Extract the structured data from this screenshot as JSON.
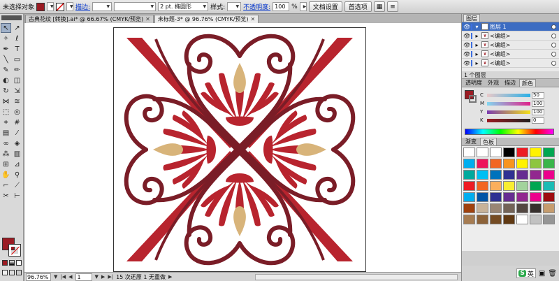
{
  "control_bar": {
    "selection_label": "未选择对象",
    "fill_color": "#9b1b23",
    "stroke_label": "描边:",
    "stroke_width": "",
    "brush_label": "2 pt. 椭圆形",
    "style_label": "样式:",
    "opacity_label": "不透明度:",
    "opacity_value": "100",
    "opacity_unit": "%",
    "doc_setup_button": "文档设置",
    "preferences_button": "首选项"
  },
  "document_tabs": [
    {
      "label": "古典花纹 [转换].ai* @ 66.67% (CMYK/预览)",
      "active": false
    },
    {
      "label": "未标题-3* @ 96.76% (CMYK/预览)",
      "active": true
    }
  ],
  "status_bar": {
    "zoom": "96.76%",
    "page": "1",
    "message": "15 次还原 1 无重做"
  },
  "layers_panel": {
    "tabs": [
      "图层"
    ],
    "rows": [
      {
        "name": "图层 1",
        "main": true
      },
      {
        "name": "<编组>",
        "main": false
      },
      {
        "name": "<编组>",
        "main": false
      },
      {
        "name": "<编组>",
        "main": false
      },
      {
        "name": "<编组>",
        "main": false
      }
    ],
    "footer": "1 个图层"
  },
  "color_panel": {
    "tabs": [
      "透明度",
      "外观",
      "描边",
      "颜色"
    ],
    "channels": [
      {
        "name": "C",
        "value": "50",
        "color": "#2bb0e6"
      },
      {
        "name": "M",
        "value": "100",
        "color": "#e0218a"
      },
      {
        "name": "Y",
        "value": "100",
        "color": "#f4e11a"
      },
      {
        "name": "K",
        "value": "0",
        "color": "#222222"
      }
    ],
    "fill_color": "#9b1b23"
  },
  "swatches_panel": {
    "tabs": [
      "渐变",
      "色板"
    ],
    "colors": [
      "#ffffff",
      "#ffffff",
      "#ffffff",
      "#000000",
      "#ed1c24",
      "#fff200",
      "#00a651",
      "#00aeef",
      "#ed145b",
      "#f26522",
      "#f7941d",
      "#fff200",
      "#8dc63f",
      "#39b54a",
      "#00a99d",
      "#00bff3",
      "#0072bc",
      "#2e3192",
      "#662d91",
      "#92278f",
      "#ec008c",
      "#ed1c24",
      "#f26522",
      "#fbaf5d",
      "#f9ed32",
      "#a3d39c",
      "#00a651",
      "#1cbbb4",
      "#00aeef",
      "#0054a6",
      "#2e3192",
      "#662d91",
      "#92278f",
      "#ec008c",
      "#9e0b0f",
      "#a0410d",
      "#c7b299",
      "#998675",
      "#736357",
      "#534741",
      "#37302d",
      "#c69c6d",
      "#a67c52",
      "#8c6239",
      "#754c24",
      "#603913",
      "#ffffff",
      "#c2c2c2",
      "#959595"
    ]
  },
  "ime": {
    "logo": "S",
    "label": "英"
  }
}
